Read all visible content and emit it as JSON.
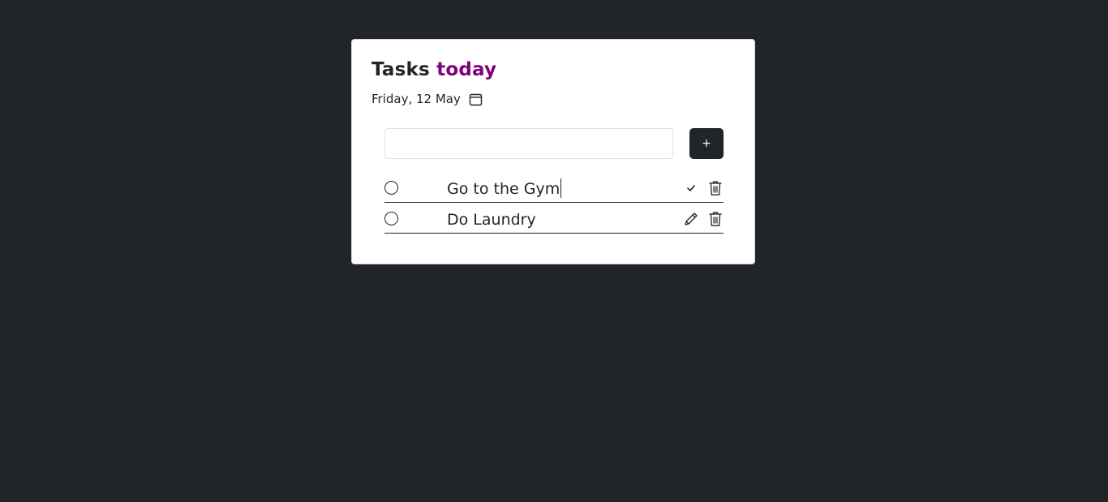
{
  "header": {
    "title_main": "Tasks",
    "title_accent": "today",
    "date": "Friday, 12 May",
    "calendar_icon": "calendar-icon"
  },
  "add_form": {
    "input_value": "",
    "input_placeholder": "",
    "add_label": "+"
  },
  "tasks": [
    {
      "text": "Go to the Gym",
      "editing": true,
      "actions": [
        "check-icon",
        "trash-icon"
      ]
    },
    {
      "text": "Do Laundry",
      "editing": false,
      "actions": [
        "pencil-icon",
        "trash-icon"
      ]
    }
  ],
  "colors": {
    "background": "#212529",
    "accent": "#800080",
    "card": "#ffffff",
    "text": "#212529"
  }
}
